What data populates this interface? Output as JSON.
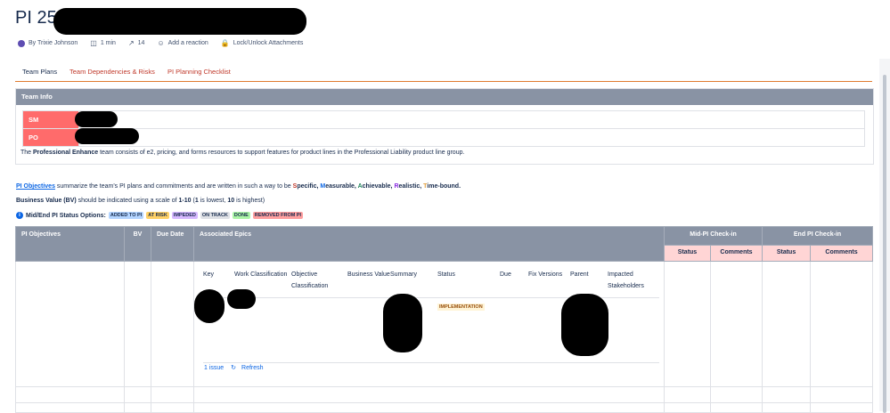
{
  "page": {
    "title": "PI 25.4",
    "byline": {
      "author": "By Trixie Johnson",
      "read_time": "1 min",
      "views": "14",
      "reaction": "Add a reaction",
      "lock": "Lock/Unlock Attachments"
    },
    "tabs": [
      "Team Plans",
      "Team Dependencies & Risks",
      "PI Planning Checklist"
    ]
  },
  "team_info": {
    "header": "Team Info",
    "rows": [
      {
        "label": "SM"
      },
      {
        "label": "PO"
      }
    ],
    "desc_pre": "The ",
    "desc_team": "Professional Enhance",
    "desc_post": " team consists of e2, pricing, and forms resources to support features for product lines in the Professional Liability product line group."
  },
  "objectives_note": {
    "link": "PI Objectives",
    "text": " summarize the team's PI plans and commitments and are written in such a way to be ",
    "s": "S",
    "s_rest": "pecific, ",
    "m": "M",
    "m_rest": "easurable, ",
    "a": "A",
    "a_rest": "chievable, ",
    "r": "R",
    "r_rest": "ealistic, ",
    "t": "T",
    "t_rest": "ime-bound."
  },
  "bv_note": {
    "lead": "Business Value (BV)",
    "text1": " should be indicated using a scale of ",
    "range": "1-10",
    "text2": " (",
    "one": "1",
    "text3": " is lowest, ",
    "ten": "10",
    "text4": " is highest)"
  },
  "status_options": {
    "label": "Mid/End PI Status Options:",
    "items": [
      {
        "text": "ADDED TO PI",
        "color": "#b3d4ff"
      },
      {
        "text": "AT RISK",
        "color": "#ffd166"
      },
      {
        "text": "IMPEDED",
        "color": "#d6b8ff"
      },
      {
        "text": "ON TRACK",
        "color": "#dfe1e6"
      },
      {
        "text": "DONE",
        "color": "#abf5a6"
      },
      {
        "text": "REMOVED FROM PI",
        "color": "#ff9f9f"
      }
    ]
  },
  "main_table": {
    "headers": {
      "objectives": "PI Objectives",
      "bv": "BV",
      "due_date": "Due Date",
      "epics": "Associated Epics",
      "mid": "Mid-PI Check-in",
      "end": "End PI Check-in",
      "mid_status": "Status",
      "mid_comments": "Comments",
      "end_status": "Status",
      "end_comments": "Comments"
    },
    "epics_columns": [
      "Key",
      "Work Classification",
      "Objective Classification",
      "Business Value",
      "Summary",
      "Status",
      "Due",
      "Fix Versions",
      "Parent",
      "Impacted Stakeholders"
    ],
    "epic_status": "IMPLEMENTATION",
    "issue_count": "1 issue",
    "refresh": "Refresh"
  },
  "colors": {
    "header_bg": "#8993a4",
    "label_red": "#ff6b6b",
    "link_blue": "#0c66e4",
    "tab_underline": "#e07b2f",
    "subheader_pink": "#ffd5d5"
  }
}
